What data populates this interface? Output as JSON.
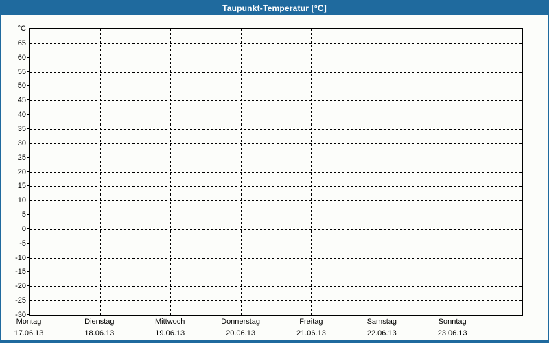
{
  "window": {
    "title": "Taupunkt-Temperatur [°C]"
  },
  "colors": {
    "titlebar_bg": "#1f6a9e",
    "titlebar_text": "#ffffff",
    "frame_border": "#1f6a9e",
    "canvas_bg": "#fcfdfa",
    "axis": "#000000",
    "grid": "#000000",
    "label_text": "#000000"
  },
  "chart_data": {
    "type": "line",
    "title": "Taupunkt-Temperatur [°C]",
    "xlabel": "",
    "ylabel": "°C",
    "ylim": [
      -30,
      70
    ],
    "ytick_step": 5,
    "yticks": [
      65,
      60,
      55,
      50,
      45,
      40,
      35,
      30,
      25,
      20,
      15,
      10,
      5,
      0,
      -5,
      -10,
      -15,
      -20,
      -25,
      -30
    ],
    "categories": [
      {
        "day": "Montag",
        "date": "17.06.13"
      },
      {
        "day": "Dienstag",
        "date": "18.06.13"
      },
      {
        "day": "Mittwoch",
        "date": "19.06.13"
      },
      {
        "day": "Donnerstag",
        "date": "20.06.13"
      },
      {
        "day": "Freitag",
        "date": "21.06.13"
      },
      {
        "day": "Samstag",
        "date": "22.06.13"
      },
      {
        "day": "Sonntag",
        "date": "23.06.13"
      }
    ],
    "series": [],
    "grid": "dashed",
    "legend_position": "none"
  }
}
